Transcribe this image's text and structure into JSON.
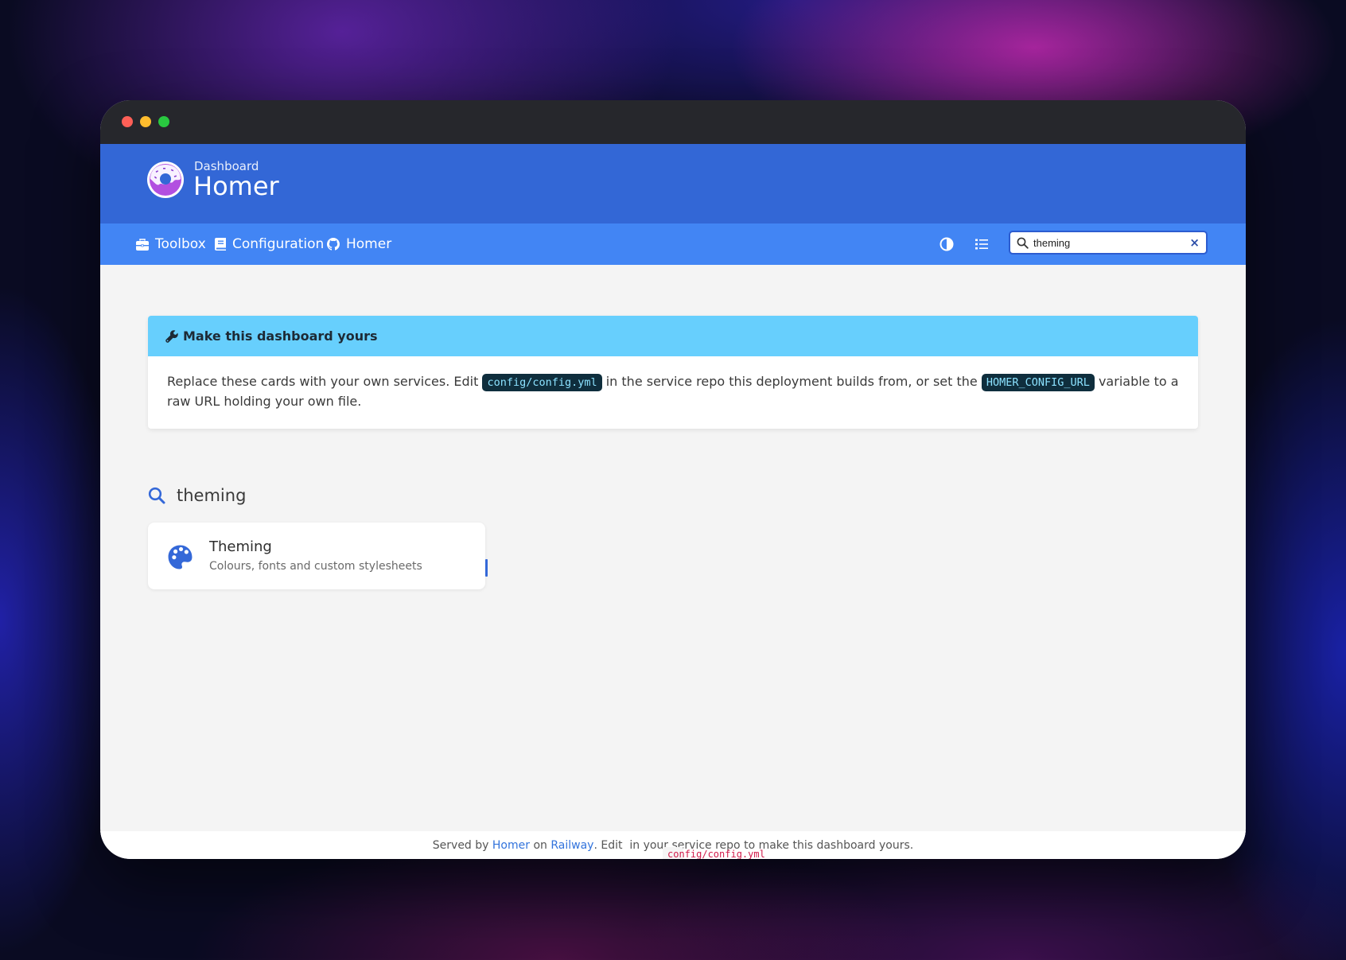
{
  "window": {
    "traffic_lights": [
      "close",
      "minimize",
      "maximize"
    ]
  },
  "header": {
    "subtitle": "Dashboard",
    "title": "Homer",
    "logo_icon": "donut-logo-icon"
  },
  "navbar": {
    "links": [
      {
        "label": "Toolbox",
        "icon": "toolbox-icon"
      },
      {
        "label": "Configuration",
        "icon": "book-icon"
      },
      {
        "label": "Homer",
        "icon": "github-icon"
      }
    ],
    "theme_toggle_icon": "contrast-icon",
    "layout_toggle_icon": "list-icon"
  },
  "search": {
    "value": "theming",
    "clear_label": "×"
  },
  "message": {
    "title": "Make this dashboard yours",
    "body_part1": "Replace these cards with your own services. Edit ",
    "code1": "config/config.yml",
    "body_part2": " in the service repo this deployment builds from, or set the ",
    "code2": "HOMER_CONFIG_URL",
    "body_part3": " variable to a raw URL holding your own file."
  },
  "results": {
    "query": "theming",
    "cards": [
      {
        "name": "Theming",
        "subtitle": "Colours, fonts and custom stylesheets",
        "icon": "palette-icon"
      }
    ]
  },
  "footer": {
    "text1": "Served by ",
    "link1": "Homer",
    "text2": " on ",
    "link2": "Railway",
    "text3": ". Edit ",
    "code": "config/config.yml",
    "text4": " in your service repo to make this dashboard yours."
  },
  "colors": {
    "header": "#3367d6",
    "navbar": "#4285f4",
    "message_header": "#67cffd",
    "accent": "#3468d8"
  }
}
